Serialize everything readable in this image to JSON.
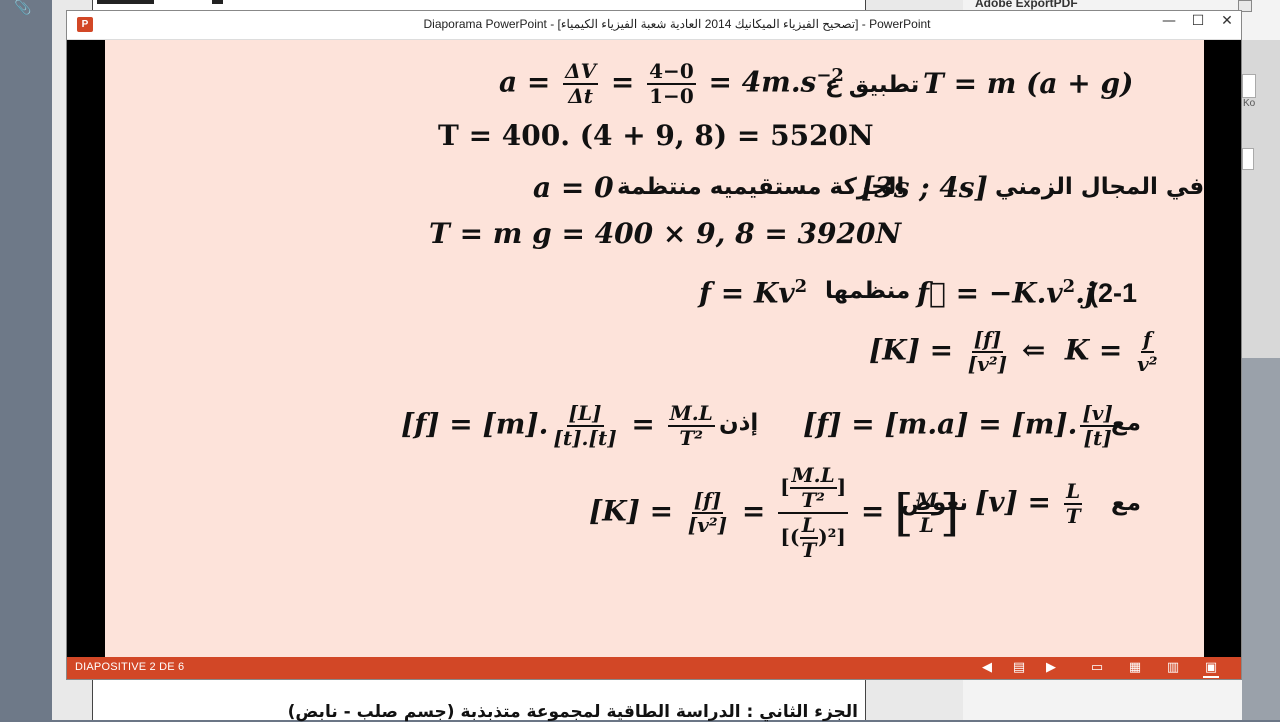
{
  "window": {
    "title": "Diaporama PowerPoint - [تصحيح الفيزياء الميكانيك 2014 العادية شعبة الفيزياء الكيمياء] - PowerPoint",
    "app_icon_letter": "P",
    "minimize": "—",
    "maximize": "☐",
    "close": "✕"
  },
  "status_bar": {
    "slide_counter": "DIAPOSITIVE 2 DE 6",
    "accent": "#d24726"
  },
  "side_panel": {
    "title": "Adobe ExportPDF",
    "fragment": "Ko"
  },
  "document": {
    "bottom_text": "الجزء الثاني : الدراسة الطاقية لمجموعة متذبذبة (جسم صلب - نابض)"
  },
  "slide": {
    "background": "#fde3da",
    "line1": {
      "a": "a",
      "dv": "ΔV",
      "dt": "Δt",
      "num": "4−0",
      "den": "1−0",
      "result": "4m.s",
      "exp": "−2",
      "apply": "تطبيق ع",
      "formula": "T = m (a + g)"
    },
    "line2": {
      "text": "T = 400. (4 + 9, 8) = 5520N"
    },
    "line3": {
      "arabic_a": "في المجال الزمني",
      "interval": "[3s ; 4s]",
      "arabic_b": "الحركة مستقيميه منتظمة",
      "cond": "a = 0"
    },
    "line4": {
      "text": "T = m g = 400 × 9, 8 = 3920N"
    },
    "line5": {
      "label": "(2-1",
      "vec": "−K.v",
      "vec_exp": "2",
      "vec_tail": ".j",
      "word": "منظمها",
      "mag": "f = Kv",
      "mag_exp": "2"
    },
    "line6": {
      "lhs": "[K] =",
      "num": "[f]",
      "den": "[v²]",
      "arrow": "⇐",
      "k": "K =",
      "knum": "f",
      "kden": "v²"
    },
    "line7": {
      "with": "مع",
      "lhs": "[f] = [m.a] = [m].",
      "n1": "[v]",
      "d1": "[t]",
      "then": "إذن",
      "rhs": "[f] = [m].",
      "n2": "[L]",
      "d2": "[t].[t]",
      "n3": "M.L",
      "d3": "T²"
    },
    "line8": {
      "with": "مع",
      "sub": "نعوض",
      "v": "[v] =",
      "vn": "L",
      "vd": "T",
      "k": "[K] =",
      "kn": "[f]",
      "kd": "[v²]",
      "bn": "M.L",
      "bd": "T²",
      "bl": "L",
      "bt": "T",
      "mn": "M",
      "md": "L"
    }
  }
}
